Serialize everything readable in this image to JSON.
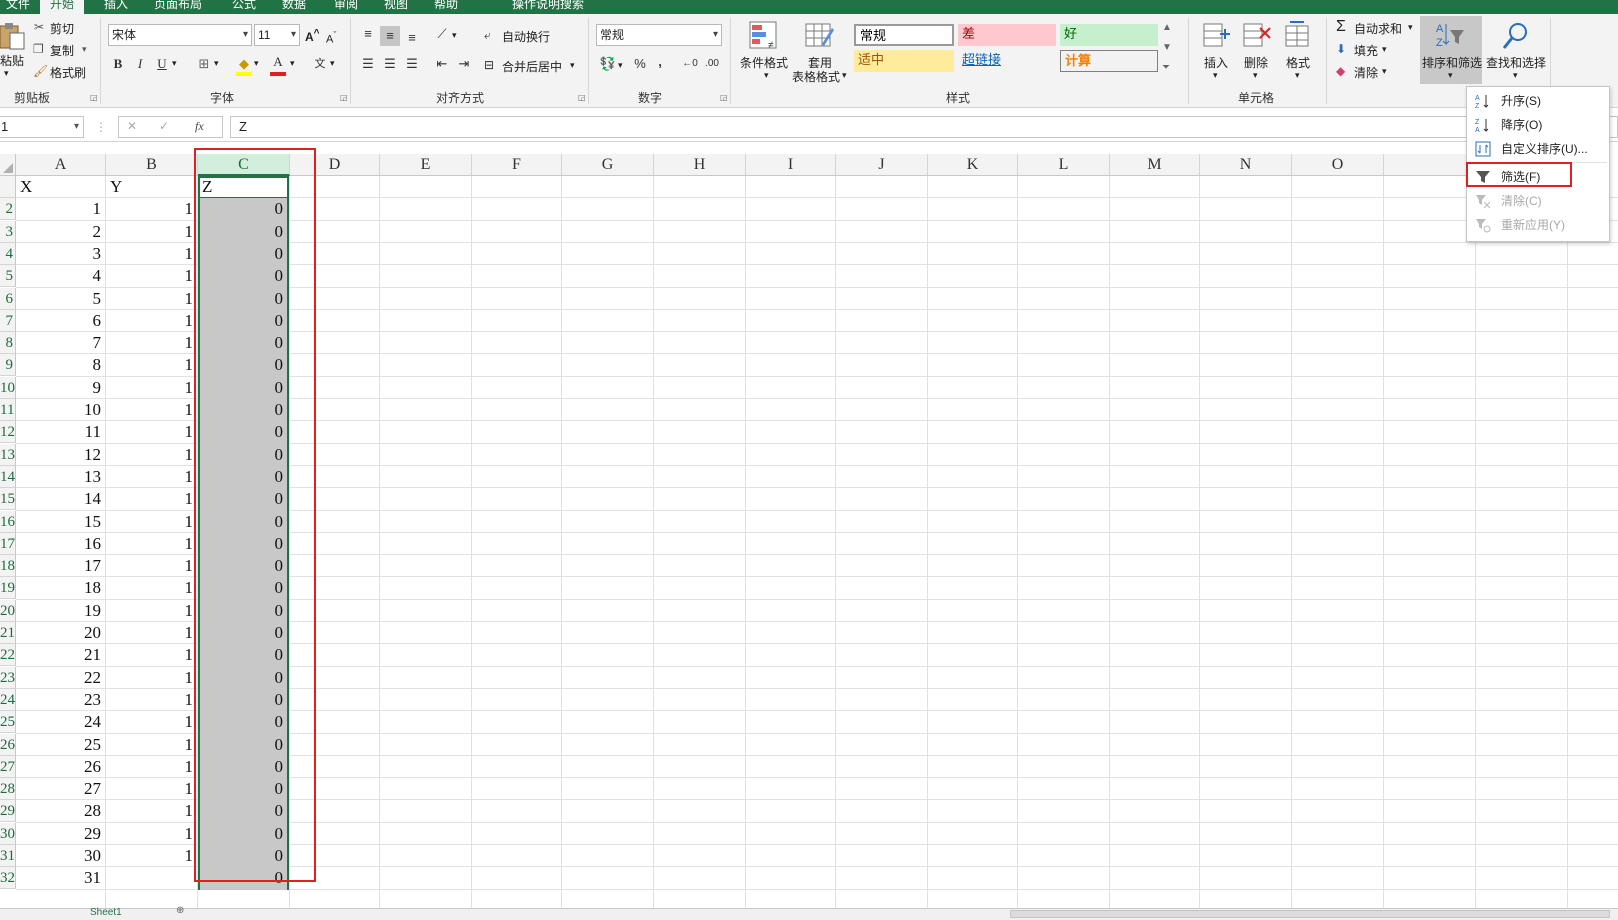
{
  "ribbon_tabs": [
    "文件",
    "开始",
    "插入",
    "页面布局",
    "公式",
    "数据",
    "审阅",
    "视图",
    "帮助",
    "操作说明搜索"
  ],
  "clipboard": {
    "paste": "粘贴",
    "cut": "剪切",
    "copy": "复制",
    "format_painter": "格式刷",
    "group": "剪贴板"
  },
  "font": {
    "name": "宋体",
    "size": "11",
    "bold": "B",
    "italic": "I",
    "underline": "U",
    "group": "字体"
  },
  "alignment": {
    "wrap": "自动换行",
    "merge": "合并后居中",
    "group": "对齐方式"
  },
  "number": {
    "format": "常规",
    "percent": "%",
    "comma": ",",
    "group": "数字"
  },
  "styles": {
    "conditional": "条件格式",
    "table_format_line1": "套用",
    "table_format_line2": "表格格式",
    "cells": [
      {
        "label": "常规",
        "bg": "#ffffff",
        "fg": "#000000"
      },
      {
        "label": "差",
        "bg": "#ffc7ce",
        "fg": "#9c0006"
      },
      {
        "label": "好",
        "bg": "#c6efce",
        "fg": "#006100"
      },
      {
        "label": "适中",
        "bg": "#ffeb9c",
        "fg": "#9c5700"
      },
      {
        "label": "超链接",
        "bg": "#f3f3f3",
        "fg": "#0563c1"
      },
      {
        "label": "计算",
        "bg": "#f2f2f2",
        "fg": "#fa7d00"
      }
    ],
    "group": "样式"
  },
  "cells_group": {
    "insert": "插入",
    "delete": "删除",
    "format": "格式",
    "group": "单元格"
  },
  "editing": {
    "autosum": "自动求和",
    "fill": "填充",
    "clear": "清除",
    "sort_filter": "排序和筛选",
    "find_select": "查找和选择"
  },
  "sort_menu": {
    "items": [
      {
        "label": "升序(S)",
        "disabled": false
      },
      {
        "label": "降序(O)",
        "disabled": false
      },
      {
        "label": "自定义排序(U)...",
        "disabled": false
      },
      {
        "label": "筛选(F)",
        "disabled": false
      },
      {
        "label": "清除(C)",
        "disabled": true
      },
      {
        "label": "重新应用(Y)",
        "disabled": true
      }
    ]
  },
  "formula_bar": {
    "name_box": "1",
    "cancel": "✕",
    "enter": "✓",
    "fx": "fx",
    "content": "Z"
  },
  "columns": [
    "A",
    "B",
    "C",
    "D",
    "E",
    "F",
    "G",
    "H",
    "I",
    "J",
    "K",
    "L",
    "M",
    "N",
    "O"
  ],
  "row_labels": [
    "",
    "2",
    "3",
    "4",
    "5",
    "6",
    "7",
    "8",
    "9",
    "10",
    "11",
    "12",
    "13",
    "14",
    "15",
    "16",
    "17",
    "18",
    "19",
    "20",
    "21",
    "22",
    "23",
    "24",
    "25",
    "26",
    "27",
    "28",
    "29",
    "30",
    "31",
    "32"
  ],
  "table": {
    "headers": [
      "X",
      "Y",
      "Z"
    ],
    "rows": [
      [
        "1",
        "1",
        "0"
      ],
      [
        "2",
        "1",
        "0"
      ],
      [
        "3",
        "1",
        "0"
      ],
      [
        "4",
        "1",
        "0"
      ],
      [
        "5",
        "1",
        "0"
      ],
      [
        "6",
        "1",
        "0"
      ],
      [
        "7",
        "1",
        "0"
      ],
      [
        "8",
        "1",
        "0"
      ],
      [
        "9",
        "1",
        "0"
      ],
      [
        "10",
        "1",
        "0"
      ],
      [
        "11",
        "1",
        "0"
      ],
      [
        "12",
        "1",
        "0"
      ],
      [
        "13",
        "1",
        "0"
      ],
      [
        "14",
        "1",
        "0"
      ],
      [
        "15",
        "1",
        "0"
      ],
      [
        "16",
        "1",
        "0"
      ],
      [
        "17",
        "1",
        "0"
      ],
      [
        "18",
        "1",
        "0"
      ],
      [
        "19",
        "1",
        "0"
      ],
      [
        "20",
        "1",
        "0"
      ],
      [
        "21",
        "1",
        "0"
      ],
      [
        "22",
        "1",
        "0"
      ],
      [
        "23",
        "1",
        "0"
      ],
      [
        "24",
        "1",
        "0"
      ],
      [
        "25",
        "1",
        "0"
      ],
      [
        "26",
        "1",
        "0"
      ],
      [
        "27",
        "1",
        "0"
      ],
      [
        "28",
        "1",
        "0"
      ],
      [
        "29",
        "1",
        "0"
      ],
      [
        "30",
        "1",
        "0"
      ],
      [
        "31",
        "",
        "0"
      ]
    ]
  },
  "sheet_tab": "Sheet1",
  "colors": {
    "accent": "#217346",
    "annotation": "#e02020",
    "selection": "#c8c8c8"
  }
}
